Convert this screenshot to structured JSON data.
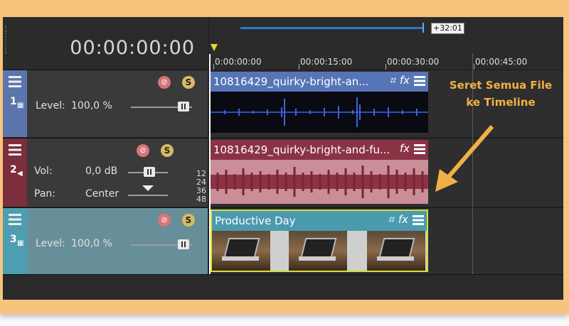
{
  "timecode": "00:00:00:00",
  "duration_badge": "+32:01",
  "ruler_ticks": [
    "0:00:00:00",
    "00:00:15:00",
    "00:00:30:00",
    "00:00:45:00"
  ],
  "tracks": [
    {
      "number": "1",
      "type_icon": "video-icon",
      "level_label": "Level:",
      "level_value": "100,0 %"
    },
    {
      "number": "2",
      "type_icon": "audio-icon",
      "vol_label": "Vol:",
      "vol_value": "0,0 dB",
      "pan_label": "Pan:",
      "pan_value": "Center",
      "meter": [
        "12",
        "24",
        "36",
        "48"
      ]
    },
    {
      "number": "3",
      "type_icon": "video-icon",
      "level_label": "Level:",
      "level_value": "100,0 %"
    }
  ],
  "clips": [
    {
      "title": "10816429_quirky-bright-an..."
    },
    {
      "title": "10816429_quirky-bright-and-fu..."
    },
    {
      "title": "Productive Day"
    }
  ],
  "callout": {
    "line1": "Seret Semua File",
    "line2": "ke Timeline"
  },
  "colors": {
    "frame": "#f6c47d",
    "callout": "#f1b045",
    "track1": "#5c75ad",
    "track2": "#7c2e3c",
    "track3": "#4d9eb0"
  }
}
